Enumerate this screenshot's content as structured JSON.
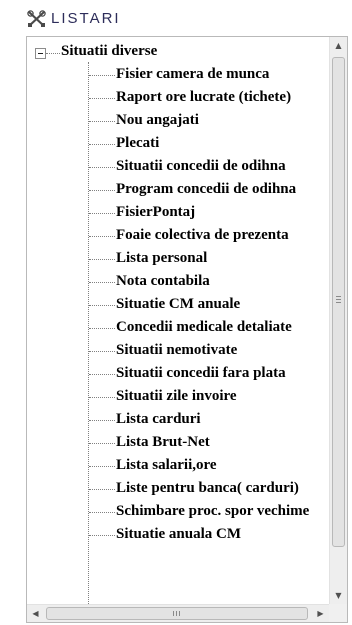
{
  "panel": {
    "title": "LISTARI",
    "icon": "tools-cross-icon"
  },
  "tree": {
    "root_label": "Situatii diverse",
    "expanded": true,
    "items": [
      {
        "label": "Fisier camera de munca"
      },
      {
        "label": "Raport ore lucrate (tichete)"
      },
      {
        "label": "Nou angajati"
      },
      {
        "label": "Plecati"
      },
      {
        "label": "Situatii concedii de odihna"
      },
      {
        "label": "Program concedii de odihna"
      },
      {
        "label": "FisierPontaj"
      },
      {
        "label": "Foaie colectiva de prezenta"
      },
      {
        "label": "Lista personal"
      },
      {
        "label": "Nota contabila"
      },
      {
        "label": "Situatie CM anuale"
      },
      {
        "label": "Concedii medicale detaliate"
      },
      {
        "label": "Situatii nemotivate"
      },
      {
        "label": "Situatii concedii fara plata"
      },
      {
        "label": "Situatii zile invoire"
      },
      {
        "label": "Lista carduri"
      },
      {
        "label": "Lista Brut-Net"
      },
      {
        "label": "Lista salarii,ore"
      },
      {
        "label": "Liste pentru banca( carduri)"
      },
      {
        "label": "Schimbare proc. spor vechime"
      },
      {
        "label": "Situatie anuala CM"
      }
    ]
  },
  "scrollbars": {
    "up_arrow": "▲",
    "down_arrow": "▼",
    "left_arrow": "◀",
    "right_arrow": "▶"
  }
}
